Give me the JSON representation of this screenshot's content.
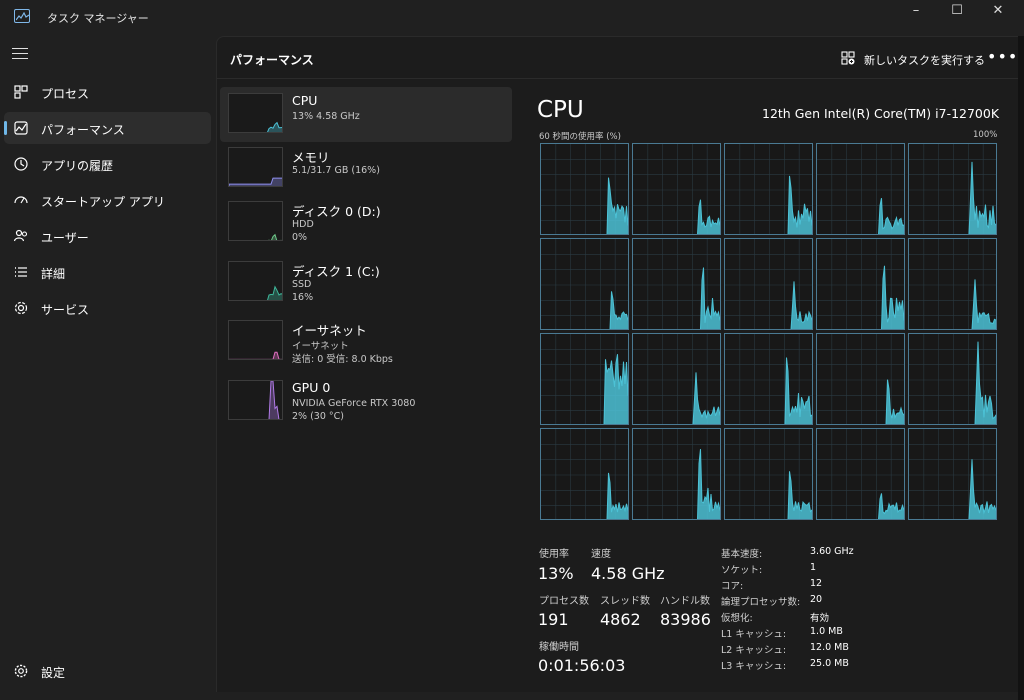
{
  "window": {
    "title": "タスク マネージャー",
    "controls": [
      "–",
      "☐",
      "✕"
    ]
  },
  "nav": {
    "items": [
      {
        "label": "プロセス",
        "icon": "processes-icon"
      },
      {
        "label": "パフォーマンス",
        "icon": "performance-icon",
        "active": true
      },
      {
        "label": "アプリの履歴",
        "icon": "app-history-icon"
      },
      {
        "label": "スタートアップ アプリ",
        "icon": "startup-icon"
      },
      {
        "label": "ユーザー",
        "icon": "users-icon"
      },
      {
        "label": "詳細",
        "icon": "details-icon"
      },
      {
        "label": "サービス",
        "icon": "services-icon"
      }
    ],
    "settings_label": "設定"
  },
  "header": {
    "title": "パフォーマンス",
    "run_task_label": "新しいタスクを実行する",
    "more": "•••"
  },
  "resources": [
    {
      "name": "CPU",
      "sub1": "13%  4.58 GHz",
      "sub2": "",
      "color": "#4cc2d6",
      "level": 0.13
    },
    {
      "name": "メモリ",
      "sub1": "5.1/31.7 GB (16%)",
      "sub2": "",
      "color": "#8e8ff0",
      "level": 0.16
    },
    {
      "name": "ディスク 0 (D:)",
      "sub1": "HDD",
      "sub2": "0%",
      "color": "#6ec88a",
      "level": 0.0
    },
    {
      "name": "ディスク 1 (C:)",
      "sub1": "SSD",
      "sub2": "16%",
      "color": "#3fb89b",
      "level": 0.16
    },
    {
      "name": "イーサネット",
      "sub1": "イーサネット",
      "sub2": "送信: 0  受信: 8.0 Kbps",
      "color": "#e06fc1",
      "level": 0.05
    },
    {
      "name": "GPU 0",
      "sub1": "NVIDIA GeForce RTX 3080",
      "sub2": "2%  (30 °C)",
      "color": "#b07ae6",
      "level": 0.02
    }
  ],
  "detail": {
    "title": "CPU",
    "model": "12th Gen Intel(R) Core(TM) i7-12700K",
    "graph_label": "60 秒間の使用率 (%)",
    "graph_max": "100%",
    "colors": {
      "accent": "#4cc2d6",
      "grid_line": "#4a7a93"
    },
    "stats": {
      "usage_label": "使用率",
      "usage_value": "13%",
      "speed_label": "速度",
      "speed_value": "4.58 GHz",
      "processes_label": "プロセス数",
      "processes_value": "191",
      "threads_label": "スレッド数",
      "threads_value": "4862",
      "handles_label": "ハンドル数",
      "handles_value": "83986",
      "uptime_label": "稼働時間",
      "uptime_value": "0:01:56:03"
    },
    "specs": [
      {
        "label": "基本速度:",
        "value": "3.60 GHz"
      },
      {
        "label": "ソケット:",
        "value": "1"
      },
      {
        "label": "コア:",
        "value": "12"
      },
      {
        "label": "論理プロセッサ数:",
        "value": "20"
      },
      {
        "label": "仮想化:",
        "value": "有効"
      },
      {
        "label": "L1 キャッシュ:",
        "value": "1.0 MB"
      },
      {
        "label": "L2 キャッシュ:",
        "value": "12.0 MB"
      },
      {
        "label": "L3 キャッシュ:",
        "value": "25.0 MB"
      }
    ],
    "core_count": 20
  }
}
